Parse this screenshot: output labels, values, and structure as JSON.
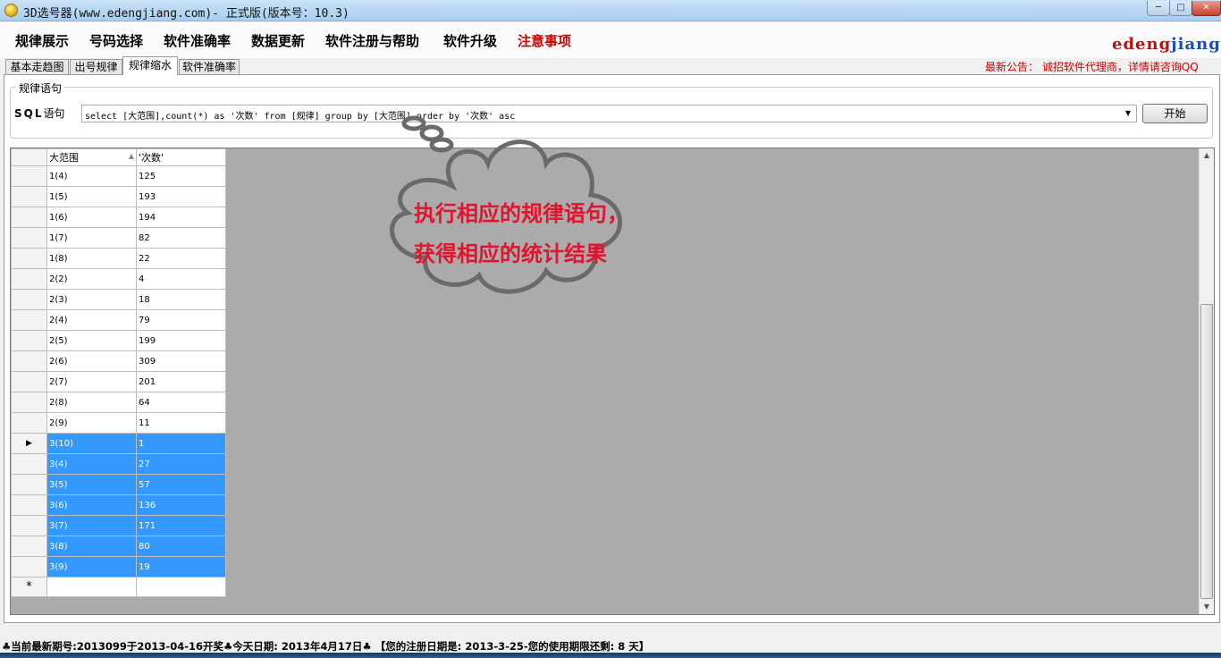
{
  "window": {
    "title": "3D选号器(www.edengjiang.com)- 正式版(版本号：10.3)",
    "controls": {
      "minimize": "─",
      "maximize": "□",
      "close": "✕"
    }
  },
  "menu": {
    "items": [
      "规律展示",
      "号码选择",
      "软件准确率",
      "数据更新",
      "软件注册与帮助",
      "软件升级",
      "注意事项"
    ],
    "logo": {
      "part1": "edeng",
      "part2": "jiang"
    }
  },
  "tabs": {
    "items": [
      "基本走趋图",
      "出号规律",
      "规律缩水",
      "软件准确率"
    ],
    "active_index": 2
  },
  "notice": "最新公告： 诚招软件代理商，详情请咨询QQ",
  "sql_section": {
    "group_title": "规律语句",
    "label_prefix": "SQL",
    "label_suffix": "语句",
    "query": "select [大范围],count(*) as '次数' from [规律] group by [大范围] order by '次数' asc",
    "start_button": "开始"
  },
  "grid": {
    "columns": [
      "大范围",
      "'次数'"
    ],
    "rows": [
      {
        "range": "1(4)",
        "count": "125"
      },
      {
        "range": "1(5)",
        "count": "193"
      },
      {
        "range": "1(6)",
        "count": "194"
      },
      {
        "range": "1(7)",
        "count": "82"
      },
      {
        "range": "1(8)",
        "count": "22"
      },
      {
        "range": "2(2)",
        "count": "4"
      },
      {
        "range": "2(3)",
        "count": "18"
      },
      {
        "range": "2(4)",
        "count": "79"
      },
      {
        "range": "2(5)",
        "count": "199"
      },
      {
        "range": "2(6)",
        "count": "309"
      },
      {
        "range": "2(7)",
        "count": "201"
      },
      {
        "range": "2(8)",
        "count": "64"
      },
      {
        "range": "2(9)",
        "count": "11"
      },
      {
        "range": "3(10)",
        "count": "1"
      },
      {
        "range": "3(4)",
        "count": "27"
      },
      {
        "range": "3(5)",
        "count": "57"
      },
      {
        "range": "3(6)",
        "count": "136"
      },
      {
        "range": "3(7)",
        "count": "171"
      },
      {
        "range": "3(8)",
        "count": "80"
      },
      {
        "range": "3(9)",
        "count": "19"
      }
    ],
    "selected_rows": [
      13,
      14,
      15,
      16,
      17,
      18,
      19
    ],
    "current_row_marker": "▶",
    "new_row_marker": "*"
  },
  "callout": {
    "text": "执行相应的规律语句，获得相应的统计结果",
    "text_color": "#e0142c"
  },
  "status": "♣当前最新期号:2013099于2013-04-16开奖♣今天日期: 2013年4月17日♣   【您的注册日期是: 2013-3-25-您的使用期限还剩: 8 天】"
}
